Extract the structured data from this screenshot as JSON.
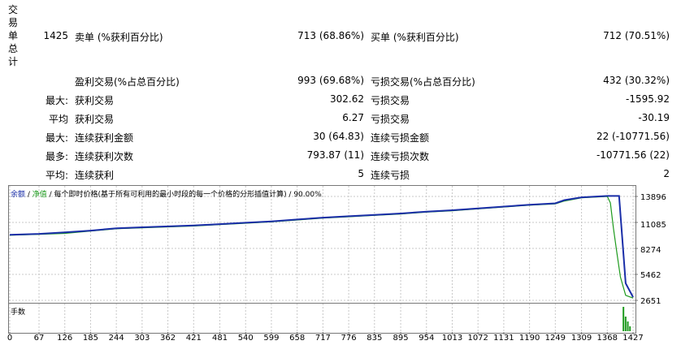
{
  "summary": {
    "vertical_title": [
      "交",
      "易",
      "单",
      "总",
      "计"
    ],
    "total_trades": "1425",
    "sell_label": "卖单 (%获利百分比)",
    "sell_value": "713 (68.86%)",
    "buy_label": "买单 (%获利百分比)",
    "buy_value": "712 (70.51%)"
  },
  "stats": {
    "profit_trades_label": "盈利交易(%占总百分比)",
    "profit_trades_value": "993 (69.68%)",
    "loss_trades_label": "亏损交易(%占总百分比)",
    "loss_trades_value": "432 (30.32%)",
    "rows": [
      {
        "prefix": "最大:",
        "left_label": "获利交易",
        "left_value": "302.62",
        "right_label": "亏损交易",
        "right_value": "-1595.92"
      },
      {
        "prefix": "平均",
        "left_label": "获利交易",
        "left_value": "6.27",
        "right_label": "亏损交易",
        "right_value": "-30.19"
      },
      {
        "prefix": "最大:",
        "left_label": "连续获利金额",
        "left_value": "30 (64.83)",
        "right_label": "连续亏损金额",
        "right_value": "22 (-10771.56)"
      },
      {
        "prefix": "最多:",
        "left_label": "连续获利次数",
        "left_value": "793.87 (11)",
        "right_label": "连续亏损次数",
        "right_value": "-10771.56 (22)"
      },
      {
        "prefix": "平均:",
        "left_label": "连续获利",
        "left_value": "5",
        "right_label": "连续亏损",
        "right_value": "2"
      }
    ]
  },
  "chart_legend": {
    "balance": "余额",
    "sep1": " / ",
    "equity": "净值",
    "rest": " / 每个即时价格(基于所有可利用的最小时段的每一个价格的分形插值计算) / 90.00%"
  },
  "volume_label": "手数",
  "colors": {
    "balance": "#1a2ea8",
    "equity": "#1d9a1d",
    "volume": "#1d9a1d"
  },
  "chart_data": {
    "type": "line",
    "x_ticks": [
      "0",
      "67",
      "126",
      "185",
      "244",
      "303",
      "362",
      "421",
      "481",
      "540",
      "599",
      "658",
      "717",
      "776",
      "835",
      "895",
      "954",
      "1013",
      "1072",
      "1131",
      "1190",
      "1249",
      "1309",
      "1368",
      "1427"
    ],
    "y_ticks": [
      "13896",
      "11085",
      "8274",
      "5462",
      "2651"
    ],
    "ylim": [
      2651,
      13896
    ],
    "xlim": [
      0,
      1427
    ],
    "series": [
      {
        "name": "余额",
        "x": [
          0,
          67,
          126,
          185,
          244,
          303,
          362,
          421,
          481,
          540,
          599,
          658,
          717,
          776,
          835,
          895,
          954,
          1013,
          1072,
          1131,
          1190,
          1249,
          1270,
          1309,
          1368,
          1380,
          1395,
          1410,
          1427
        ],
        "y": [
          9750,
          9850,
          10000,
          10200,
          10450,
          10560,
          10650,
          10750,
          10900,
          11050,
          11200,
          11400,
          11600,
          11750,
          11900,
          12050,
          12250,
          12400,
          12600,
          12800,
          13000,
          13150,
          13500,
          13800,
          13950,
          13950,
          13950,
          4500,
          3000
        ]
      },
      {
        "name": "净值",
        "x": [
          0,
          67,
          126,
          185,
          244,
          303,
          362,
          421,
          481,
          540,
          599,
          658,
          717,
          776,
          835,
          895,
          954,
          1013,
          1072,
          1131,
          1190,
          1249,
          1270,
          1309,
          1368,
          1375,
          1382,
          1390,
          1398,
          1410,
          1427
        ],
        "y": [
          9700,
          9800,
          9900,
          10150,
          10400,
          10500,
          10600,
          10700,
          10850,
          11000,
          11150,
          11350,
          11550,
          11700,
          11850,
          12000,
          12200,
          12350,
          12550,
          12750,
          12950,
          13100,
          13400,
          13750,
          13900,
          13200,
          10500,
          7800,
          5200,
          3200,
          2900
        ]
      }
    ],
    "volume": {
      "x": [
        1405,
        1410,
        1415,
        1420
      ],
      "values": [
        1,
        0.6,
        0.4,
        0.2
      ]
    }
  }
}
